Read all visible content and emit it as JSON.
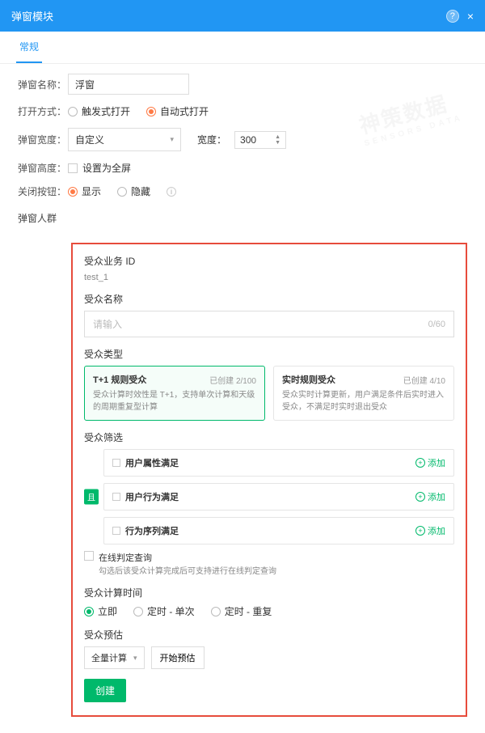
{
  "header": {
    "title": "弹窗模块"
  },
  "tabs": {
    "general": "常规"
  },
  "form": {
    "name_label": "弹窗名称：",
    "name_value": "浮窗",
    "open_label": "打开方式：",
    "open_opt1": "触发式打开",
    "open_opt2": "自动式打开",
    "width_label": "弹窗宽度：",
    "width_select": "自定义",
    "width_sub_label": "宽度：",
    "width_value": "300",
    "height_label": "弹窗高度：",
    "height_check": "设置为全屏",
    "close_label": "关闭按钮：",
    "close_opt1": "显示",
    "close_opt2": "隐藏"
  },
  "audience": {
    "section_label": "弹窗人群",
    "biz_id_label": "受众业务 ID",
    "biz_id_value": "test_1",
    "name_label": "受众名称",
    "name_placeholder": "请输入",
    "name_counter": "0/60",
    "type_label": "受众类型",
    "type1": {
      "title": "T+1 规则受众",
      "meta": "已创建 2/100",
      "desc": "受众计算时效性是 T+1，支持单次计算和天级的周期重复型计算"
    },
    "type2": {
      "title": "实时规则受众",
      "meta": "已创建 4/10",
      "desc": "受众实时计算更新，用户满足条件后实时进入受众，不满足时实时退出受众"
    },
    "filter_label": "受众筛选",
    "and_chip": "且",
    "filters": {
      "0": {
        "label": "用户属性满足",
        "action": "添加"
      },
      "1": {
        "label": "用户行为满足",
        "action": "添加"
      },
      "2": {
        "label": "行为序列满足",
        "action": "添加"
      }
    },
    "online_check": "在线判定查询",
    "online_desc": "勾选后该受众计算完成后可支持进行在线判定查询",
    "calc_label": "受众计算时间",
    "calc_opt1": "立即",
    "calc_opt2": "定时 - 单次",
    "calc_opt3": "定时 - 重复",
    "est_label": "受众预估",
    "est_select": "全量计算",
    "est_button": "开始预估",
    "create_button": "创建"
  },
  "watermark_text": "神策数据",
  "watermark_sub": "SENSORS DATA"
}
